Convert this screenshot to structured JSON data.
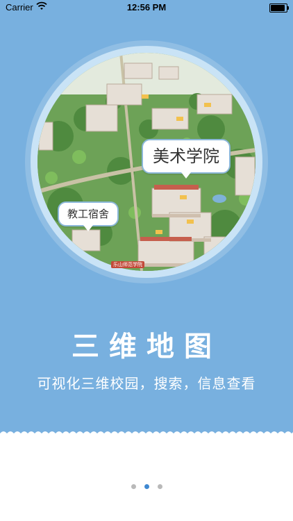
{
  "status_bar": {
    "carrier": "Carrier",
    "time": "12:56 PM",
    "battery_level": 1.0
  },
  "hero": {
    "labels": {
      "art_college": "美术学院",
      "staff_dorm": "教工宿舍",
      "sign": "乐山师范学院"
    },
    "title": "三维地图",
    "subtitle": "可视化三维校园，搜索，信息查看"
  },
  "pager": {
    "count": 3,
    "active_index": 1
  },
  "colors": {
    "hero_bg": "#78b0df",
    "dot_active": "#3f88d1",
    "dot_inactive": "#b9b9b9"
  }
}
